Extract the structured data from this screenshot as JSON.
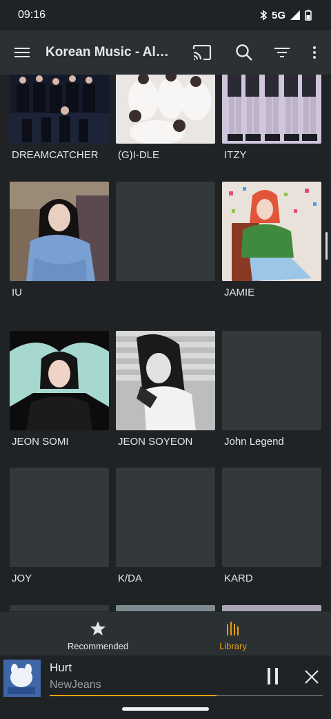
{
  "status": {
    "time": "09:16",
    "network": "5G"
  },
  "appbar": {
    "title": "Korean Music - Albu...",
    "icons": [
      "menu-icon",
      "cast-icon",
      "search-icon",
      "filter-icon",
      "more-vert-icon"
    ]
  },
  "grid": {
    "rows": [
      [
        "DREAMCATCHER",
        "(G)I-DLE",
        "ITZY"
      ],
      [
        "IU",
        "",
        "JAMIE"
      ],
      [
        "JEON SOMI",
        "JEON SOYEON",
        "John Legend"
      ],
      [
        "JOY",
        "K/DA",
        "KARD"
      ]
    ]
  },
  "bottom_nav": {
    "recommended": "Recommended",
    "library": "Library",
    "active": "library"
  },
  "mini_player": {
    "title": "Hurt",
    "artist": "NewJeans",
    "progress": 0.61
  },
  "colors": {
    "accent": "#e5a00d",
    "background": "#1f2326",
    "toolbar": "#2b3033",
    "placeholder": "#33383b"
  }
}
